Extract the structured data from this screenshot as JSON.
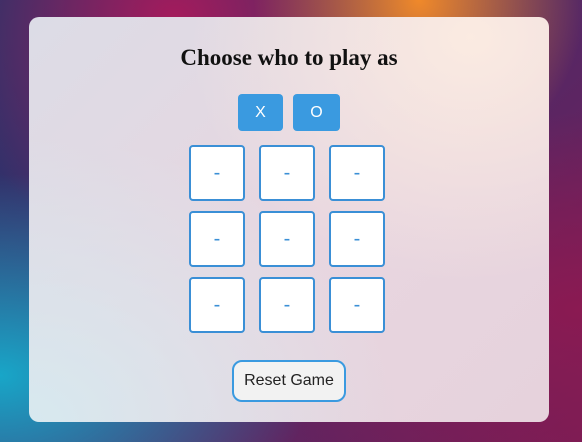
{
  "game": {
    "title": "Choose who to play as",
    "choices": [
      "X",
      "O"
    ],
    "board": [
      "-",
      "-",
      "-",
      "-",
      "-",
      "-",
      "-",
      "-",
      "-"
    ],
    "reset_label": "Reset Game"
  },
  "colors": {
    "accent": "#3a9ae0",
    "cell_border": "#3a8fd6",
    "cell_background": "#ffffff",
    "title_text": "#111111"
  }
}
